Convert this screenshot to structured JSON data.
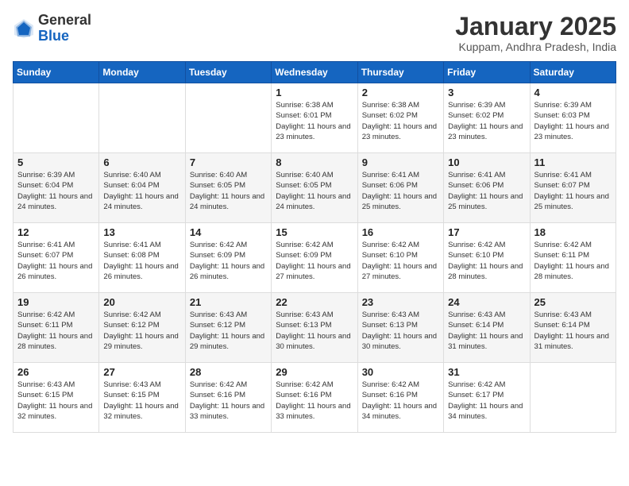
{
  "header": {
    "logo_general": "General",
    "logo_blue": "Blue",
    "month_title": "January 2025",
    "location": "Kuppam, Andhra Pradesh, India"
  },
  "weekdays": [
    "Sunday",
    "Monday",
    "Tuesday",
    "Wednesday",
    "Thursday",
    "Friday",
    "Saturday"
  ],
  "weeks": [
    [
      {
        "day": "",
        "info": ""
      },
      {
        "day": "",
        "info": ""
      },
      {
        "day": "",
        "info": ""
      },
      {
        "day": "1",
        "info": "Sunrise: 6:38 AM\nSunset: 6:01 PM\nDaylight: 11 hours\nand 23 minutes."
      },
      {
        "day": "2",
        "info": "Sunrise: 6:38 AM\nSunset: 6:02 PM\nDaylight: 11 hours\nand 23 minutes."
      },
      {
        "day": "3",
        "info": "Sunrise: 6:39 AM\nSunset: 6:02 PM\nDaylight: 11 hours\nand 23 minutes."
      },
      {
        "day": "4",
        "info": "Sunrise: 6:39 AM\nSunset: 6:03 PM\nDaylight: 11 hours\nand 23 minutes."
      }
    ],
    [
      {
        "day": "5",
        "info": "Sunrise: 6:39 AM\nSunset: 6:04 PM\nDaylight: 11 hours\nand 24 minutes."
      },
      {
        "day": "6",
        "info": "Sunrise: 6:40 AM\nSunset: 6:04 PM\nDaylight: 11 hours\nand 24 minutes."
      },
      {
        "day": "7",
        "info": "Sunrise: 6:40 AM\nSunset: 6:05 PM\nDaylight: 11 hours\nand 24 minutes."
      },
      {
        "day": "8",
        "info": "Sunrise: 6:40 AM\nSunset: 6:05 PM\nDaylight: 11 hours\nand 24 minutes."
      },
      {
        "day": "9",
        "info": "Sunrise: 6:41 AM\nSunset: 6:06 PM\nDaylight: 11 hours\nand 25 minutes."
      },
      {
        "day": "10",
        "info": "Sunrise: 6:41 AM\nSunset: 6:06 PM\nDaylight: 11 hours\nand 25 minutes."
      },
      {
        "day": "11",
        "info": "Sunrise: 6:41 AM\nSunset: 6:07 PM\nDaylight: 11 hours\nand 25 minutes."
      }
    ],
    [
      {
        "day": "12",
        "info": "Sunrise: 6:41 AM\nSunset: 6:07 PM\nDaylight: 11 hours\nand 26 minutes."
      },
      {
        "day": "13",
        "info": "Sunrise: 6:41 AM\nSunset: 6:08 PM\nDaylight: 11 hours\nand 26 minutes."
      },
      {
        "day": "14",
        "info": "Sunrise: 6:42 AM\nSunset: 6:09 PM\nDaylight: 11 hours\nand 26 minutes."
      },
      {
        "day": "15",
        "info": "Sunrise: 6:42 AM\nSunset: 6:09 PM\nDaylight: 11 hours\nand 27 minutes."
      },
      {
        "day": "16",
        "info": "Sunrise: 6:42 AM\nSunset: 6:10 PM\nDaylight: 11 hours\nand 27 minutes."
      },
      {
        "day": "17",
        "info": "Sunrise: 6:42 AM\nSunset: 6:10 PM\nDaylight: 11 hours\nand 28 minutes."
      },
      {
        "day": "18",
        "info": "Sunrise: 6:42 AM\nSunset: 6:11 PM\nDaylight: 11 hours\nand 28 minutes."
      }
    ],
    [
      {
        "day": "19",
        "info": "Sunrise: 6:42 AM\nSunset: 6:11 PM\nDaylight: 11 hours\nand 28 minutes."
      },
      {
        "day": "20",
        "info": "Sunrise: 6:42 AM\nSunset: 6:12 PM\nDaylight: 11 hours\nand 29 minutes."
      },
      {
        "day": "21",
        "info": "Sunrise: 6:43 AM\nSunset: 6:12 PM\nDaylight: 11 hours\nand 29 minutes."
      },
      {
        "day": "22",
        "info": "Sunrise: 6:43 AM\nSunset: 6:13 PM\nDaylight: 11 hours\nand 30 minutes."
      },
      {
        "day": "23",
        "info": "Sunrise: 6:43 AM\nSunset: 6:13 PM\nDaylight: 11 hours\nand 30 minutes."
      },
      {
        "day": "24",
        "info": "Sunrise: 6:43 AM\nSunset: 6:14 PM\nDaylight: 11 hours\nand 31 minutes."
      },
      {
        "day": "25",
        "info": "Sunrise: 6:43 AM\nSunset: 6:14 PM\nDaylight: 11 hours\nand 31 minutes."
      }
    ],
    [
      {
        "day": "26",
        "info": "Sunrise: 6:43 AM\nSunset: 6:15 PM\nDaylight: 11 hours\nand 32 minutes."
      },
      {
        "day": "27",
        "info": "Sunrise: 6:43 AM\nSunset: 6:15 PM\nDaylight: 11 hours\nand 32 minutes."
      },
      {
        "day": "28",
        "info": "Sunrise: 6:42 AM\nSunset: 6:16 PM\nDaylight: 11 hours\nand 33 minutes."
      },
      {
        "day": "29",
        "info": "Sunrise: 6:42 AM\nSunset: 6:16 PM\nDaylight: 11 hours\nand 33 minutes."
      },
      {
        "day": "30",
        "info": "Sunrise: 6:42 AM\nSunset: 6:16 PM\nDaylight: 11 hours\nand 34 minutes."
      },
      {
        "day": "31",
        "info": "Sunrise: 6:42 AM\nSunset: 6:17 PM\nDaylight: 11 hours\nand 34 minutes."
      },
      {
        "day": "",
        "info": ""
      }
    ]
  ]
}
